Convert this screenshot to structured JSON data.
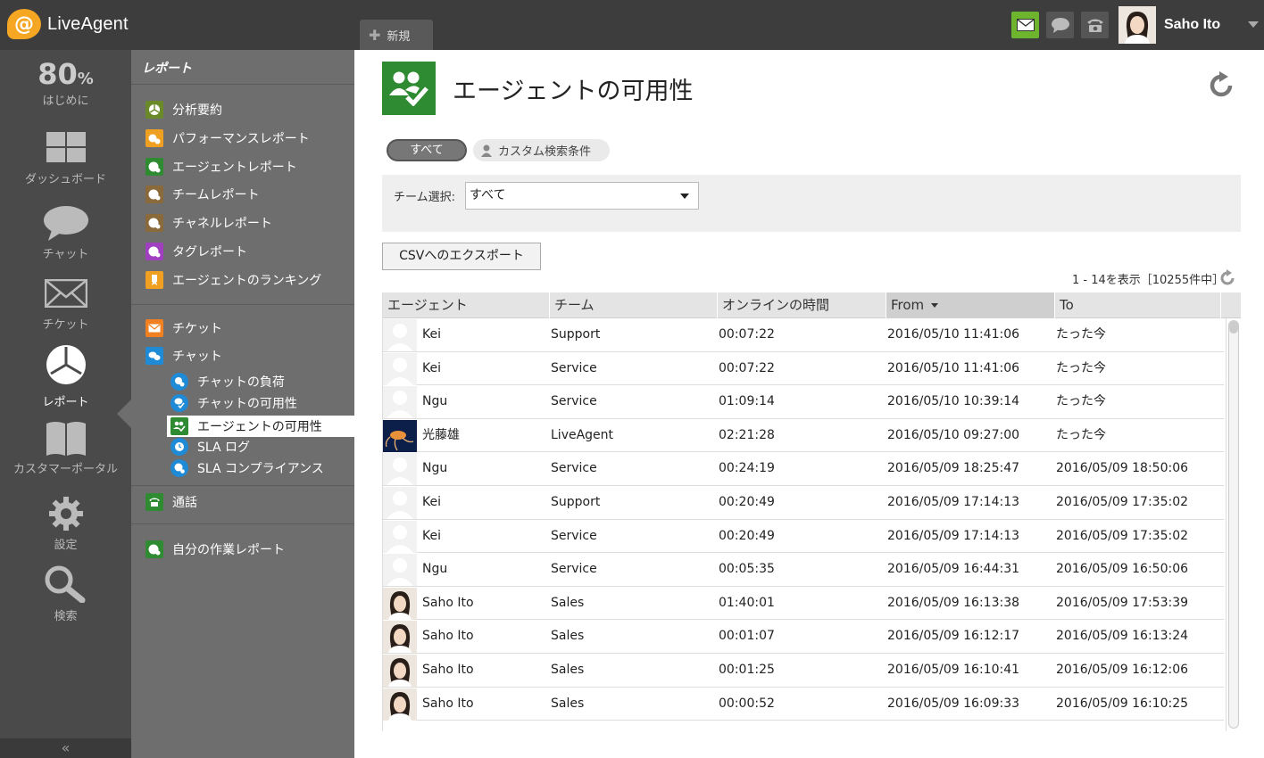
{
  "app": {
    "name": "LiveAgent",
    "new_tab_label": "新規"
  },
  "user": {
    "name": "Saho Ito"
  },
  "rail": {
    "items": [
      {
        "big": "80",
        "big_suffix": "%",
        "label": "はじめに"
      },
      {
        "label": "ダッシュボード",
        "icon": "dashboard-icon"
      },
      {
        "label": "チャット",
        "icon": "chat-icon"
      },
      {
        "label": "チケット",
        "icon": "ticket-icon"
      },
      {
        "label": "レポート",
        "icon": "report-icon"
      },
      {
        "label": "カスタマーポータル",
        "icon": "book-icon"
      },
      {
        "label": "設定",
        "icon": "gear-icon"
      },
      {
        "label": "検索",
        "icon": "search-icon"
      }
    ],
    "collapse_label": "«"
  },
  "submenu": {
    "title": "レポート",
    "items": [
      {
        "label": "分析要約",
        "color": "#6a8a2a"
      },
      {
        "label": "パフォーマンスレポート",
        "color": "#f0a020"
      },
      {
        "label": "エージェントレポート",
        "color": "#2e8b32"
      },
      {
        "label": "チームレポート",
        "color": "#8a6a3a"
      },
      {
        "label": "チャネルレポート",
        "color": "#8a6a3a"
      },
      {
        "label": "タグレポート",
        "color": "#a040c0"
      },
      {
        "label": "エージェントのランキング",
        "color": "#f0a020"
      }
    ],
    "group2": [
      {
        "label": "チケット",
        "color": "#f08020"
      },
      {
        "label": "チャット",
        "color": "#1f8ad6"
      }
    ],
    "chat_subitems": [
      {
        "label": "チャットの負荷"
      },
      {
        "label": "チャットの可用性"
      },
      {
        "label": "エージェントの可用性"
      },
      {
        "label": "SLA ログ"
      },
      {
        "label": "SLA コンプライアンス"
      }
    ],
    "call_label": "通話",
    "my_report_label": "自分の作業レポート"
  },
  "page": {
    "title": "エージェントの可用性",
    "filter_all": "すべて",
    "filter_custom": "カスタム検索条件",
    "team_label": "チーム選択:",
    "team_value": "すべて",
    "csv_label": "CSVへのエクスポート",
    "pager": "1 - 14を表示［10255件中］"
  },
  "table": {
    "columns": [
      "エージェント",
      "チーム",
      "オンラインの時間",
      "From",
      "To"
    ],
    "rows": [
      {
        "agent": "Kei",
        "team": "Support",
        "online": "00:07:22",
        "from": "2016/05/10 11:41:06",
        "to": "たった今",
        "avatar": "blank"
      },
      {
        "agent": "Kei",
        "team": "Service",
        "online": "00:07:22",
        "from": "2016/05/10 11:41:06",
        "to": "たった今",
        "avatar": "blank"
      },
      {
        "agent": "Ngu",
        "team": "Service",
        "online": "01:09:14",
        "from": "2016/05/10 10:39:14",
        "to": "たった今",
        "avatar": "blank"
      },
      {
        "agent": "光藤雄",
        "team": "LiveAgent",
        "online": "02:21:28",
        "from": "2016/05/10 09:27:00",
        "to": "たった今",
        "avatar": "jelly"
      },
      {
        "agent": "Ngu",
        "team": "Service",
        "online": "00:24:19",
        "from": "2016/05/09 18:25:47",
        "to": "2016/05/09 18:50:06",
        "avatar": "blank"
      },
      {
        "agent": "Kei",
        "team": "Support",
        "online": "00:20:49",
        "from": "2016/05/09 17:14:13",
        "to": "2016/05/09 17:35:02",
        "avatar": "blank"
      },
      {
        "agent": "Kei",
        "team": "Service",
        "online": "00:20:49",
        "from": "2016/05/09 17:14:13",
        "to": "2016/05/09 17:35:02",
        "avatar": "blank"
      },
      {
        "agent": "Ngu",
        "team": "Service",
        "online": "00:05:35",
        "from": "2016/05/09 16:44:31",
        "to": "2016/05/09 16:50:06",
        "avatar": "blank"
      },
      {
        "agent": "Saho Ito",
        "team": "Sales",
        "online": "01:40:01",
        "from": "2016/05/09 16:13:38",
        "to": "2016/05/09 17:53:39",
        "avatar": "person"
      },
      {
        "agent": "Saho Ito",
        "team": "Sales",
        "online": "00:01:07",
        "from": "2016/05/09 16:12:17",
        "to": "2016/05/09 16:13:24",
        "avatar": "person"
      },
      {
        "agent": "Saho Ito",
        "team": "Sales",
        "online": "00:01:25",
        "from": "2016/05/09 16:10:41",
        "to": "2016/05/09 16:12:06",
        "avatar": "person"
      },
      {
        "agent": "Saho Ito",
        "team": "Sales",
        "online": "00:00:52",
        "from": "2016/05/09 16:09:33",
        "to": "2016/05/09 16:10:25",
        "avatar": "person"
      }
    ]
  },
  "colors": {
    "accent_green": "#2e8b32",
    "mail_green": "#6cb52d",
    "chat_blue": "#1f8ad6"
  }
}
